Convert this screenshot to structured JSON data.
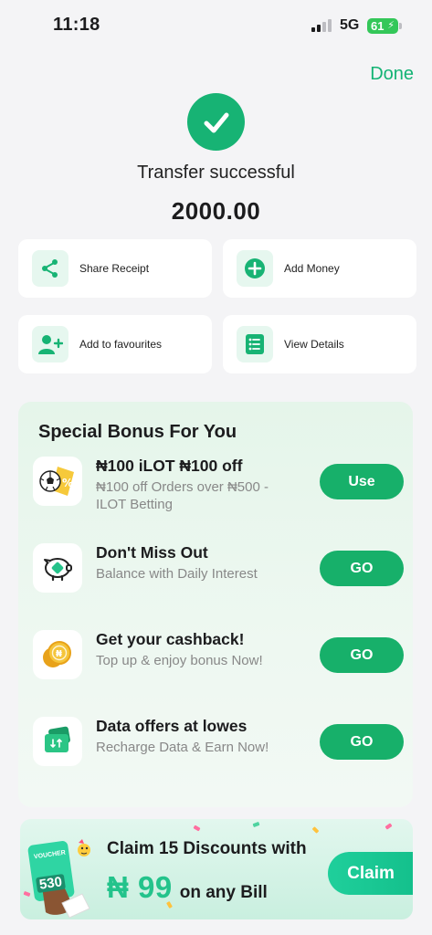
{
  "status_bar": {
    "time": "11:18",
    "network": "5G",
    "battery": "61"
  },
  "header": {
    "done_label": "Done"
  },
  "transfer": {
    "title": "Transfer successful",
    "amount": "2000.00"
  },
  "actions": [
    {
      "label": "Share Receipt",
      "icon": "share-icon"
    },
    {
      "label": "Add Money",
      "icon": "plus-circle-icon"
    },
    {
      "label": "Add to favourites",
      "icon": "add-user-icon"
    },
    {
      "label": "View Details",
      "icon": "list-icon"
    }
  ],
  "bonus": {
    "title": "Special Bonus For You",
    "items": [
      {
        "name": "₦100 iLOT ₦100 off",
        "desc": "₦100 off Orders over ₦500 - ILOT Betting",
        "button": "Use",
        "icon": "soccer-ball-icon"
      },
      {
        "name": "Don't Miss Out",
        "desc": "Balance with Daily Interest",
        "button": "GO",
        "icon": "piggy-bank-icon"
      },
      {
        "name": "Get your cashback!",
        "desc": "Top up & enjoy bonus Now!",
        "button": "GO",
        "icon": "coins-icon"
      },
      {
        "name": "Data offers at lowes",
        "desc": "Recharge Data & Earn Now!",
        "button": "GO",
        "icon": "data-card-icon"
      }
    ]
  },
  "promo": {
    "headline": "Claim 15 Discounts with",
    "amount": "₦ 99",
    "suffix": "on any Bill",
    "claim_label": "Claim",
    "voucher_tag": "VOUCHER",
    "voucher_value": "530"
  },
  "colors": {
    "accent": "#17b374",
    "promo_green": "#23c38b"
  }
}
